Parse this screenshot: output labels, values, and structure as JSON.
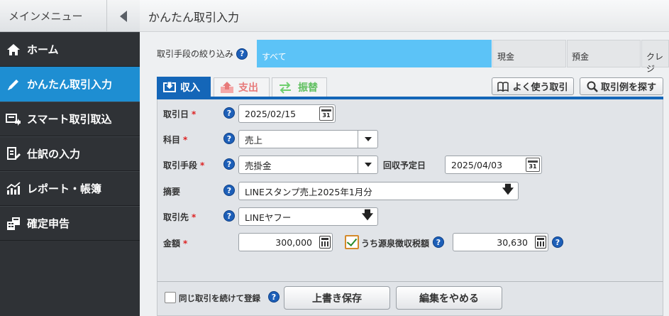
{
  "sidebar": {
    "title": "メインメニュー",
    "items": [
      {
        "label": "ホーム",
        "icon": "home-icon"
      },
      {
        "label": "かんたん取引入力",
        "icon": "pencil-icon",
        "active": true
      },
      {
        "label": "スマート取引取込",
        "icon": "import-icon"
      },
      {
        "label": "仕訳の入力",
        "icon": "journal-icon"
      },
      {
        "label": "レポート・帳簿",
        "icon": "report-chart-icon"
      },
      {
        "label": "確定申告",
        "icon": "tax-return-icon"
      }
    ]
  },
  "header": {
    "title": "かんたん取引入力"
  },
  "filter": {
    "label": "取引手段の絞り込み",
    "tabs": [
      "すべて",
      "現金",
      "預金",
      "クレジ"
    ]
  },
  "type_tabs": {
    "income": "収入",
    "expense": "支出",
    "transfer": "振替"
  },
  "actions": {
    "favorites": "よく使う取引",
    "search_examples": "取引例を探す"
  },
  "form": {
    "date": {
      "label": "取引日",
      "value": "2025/02/15",
      "cal_day": "31"
    },
    "account": {
      "label": "科目",
      "value": "売上"
    },
    "method": {
      "label": "取引手段",
      "value": "売掛金"
    },
    "collect_date": {
      "label": "回収予定日",
      "value": "2025/04/03"
    },
    "memo": {
      "label": "摘要",
      "value": "LINEスタンプ売上2025年1月分"
    },
    "partner": {
      "label": "取引先",
      "value": "LINEヤフー"
    },
    "amount": {
      "label": "金額",
      "value": "300,000"
    },
    "withholding": {
      "label": "うち源泉徴収税額",
      "checked": true,
      "value": "30,630"
    }
  },
  "footer": {
    "continue_label": "同じ取引を続けて登録",
    "save": "上書き保存",
    "cancel": "編集をやめる"
  },
  "colors": {
    "accent": "#1e8ed2",
    "income_tab": "#1466b8",
    "filter_active": "#5cc3f7"
  }
}
